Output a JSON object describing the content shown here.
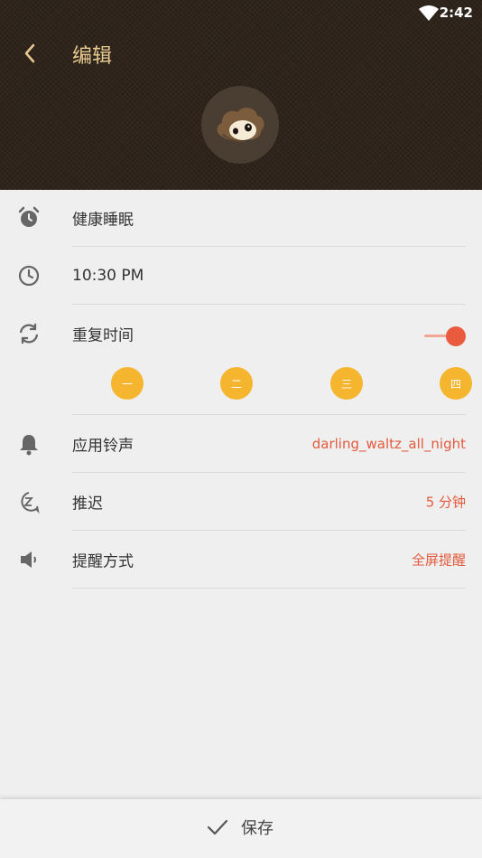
{
  "status_bar": {
    "time": "2:42"
  },
  "header": {
    "title": "编辑"
  },
  "rows": {
    "alarm_name": "健康睡眠",
    "time": "10:30 PM",
    "repeat": {
      "label": "重复时间",
      "enabled": true,
      "days": [
        "一",
        "二",
        "三",
        "四"
      ]
    },
    "ringtone": {
      "label": "应用铃声",
      "value": "darling_waltz_all_night"
    },
    "snooze": {
      "label": "推迟",
      "value": "5 分钟"
    },
    "reminder": {
      "label": "提醒方式",
      "value": "全屏提醒"
    }
  },
  "footer": {
    "save_label": "保存"
  },
  "colors": {
    "accent": "#ea5a3e",
    "day_chip": "#f5b52e",
    "title": "#e8c98f",
    "header_bg": "#2e241b"
  }
}
